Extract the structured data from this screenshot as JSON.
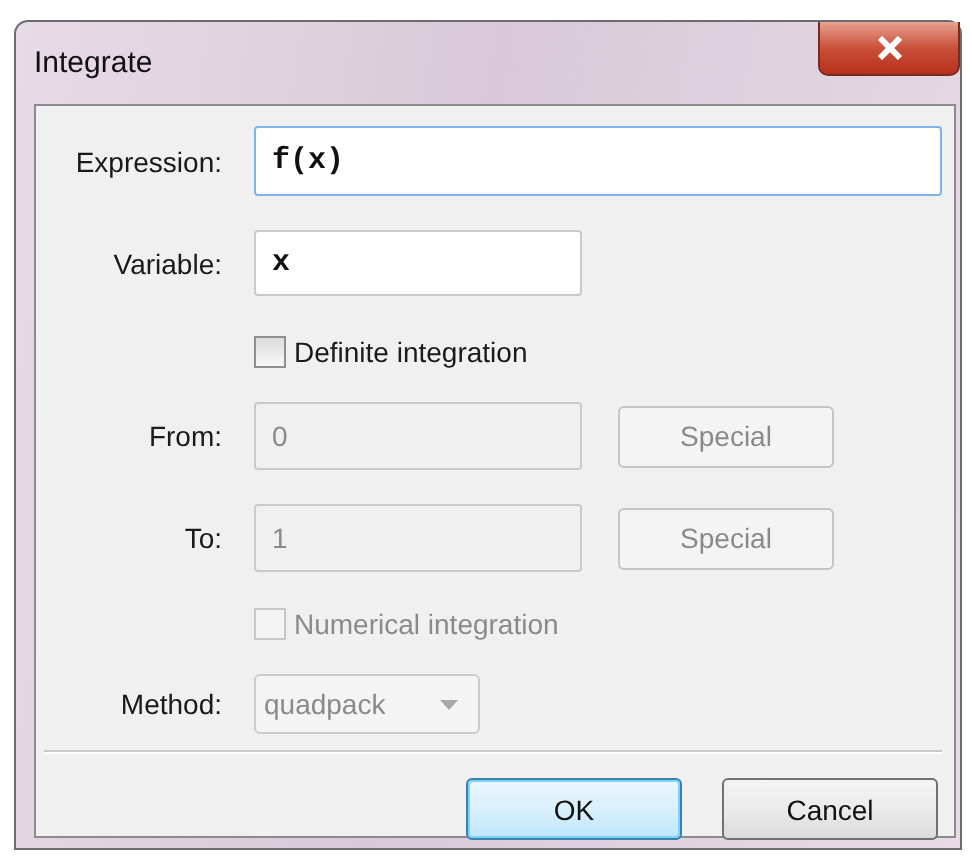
{
  "window": {
    "title": "Integrate"
  },
  "rows": [
    {
      "kind": "wide-field",
      "label": "Expression:",
      "value": "f(x)"
    },
    {
      "kind": "field",
      "label": "Variable:",
      "value": "x"
    },
    {
      "kind": "checkbox",
      "label": "Definite integration",
      "checked": false,
      "disabled": false
    },
    {
      "kind": "limit",
      "label": "From:",
      "value": "0",
      "button": "Special",
      "disabled": true
    },
    {
      "kind": "limit",
      "label": "To:",
      "value": "1",
      "button": "Special",
      "disabled": true
    },
    {
      "kind": "checkbox",
      "label": "Numerical integration",
      "checked": false,
      "disabled": true
    },
    {
      "kind": "combo",
      "label": "Method:",
      "value": "quadpack",
      "disabled": true
    }
  ],
  "buttons": [
    {
      "label": "OK",
      "default": true
    },
    {
      "label": "Cancel",
      "default": false
    }
  ]
}
